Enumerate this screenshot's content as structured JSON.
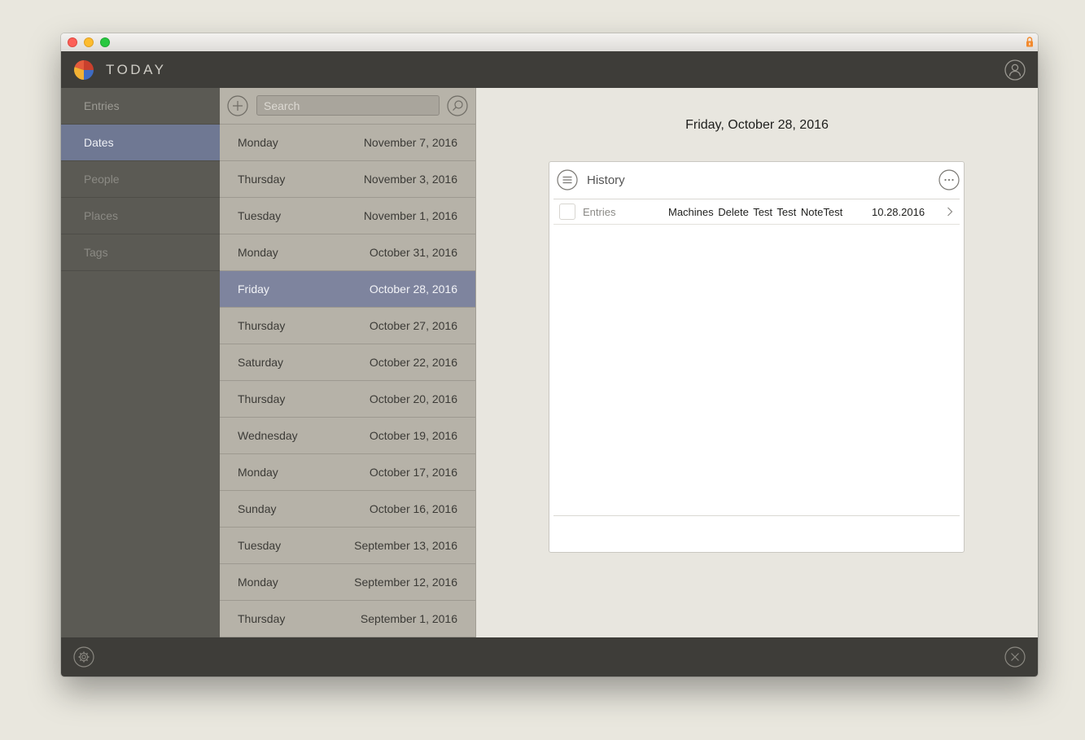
{
  "app": {
    "title": "TODAY"
  },
  "sidebar": {
    "items": [
      {
        "label": "Entries"
      },
      {
        "label": "Dates"
      },
      {
        "label": "People"
      },
      {
        "label": "Places"
      },
      {
        "label": "Tags"
      }
    ],
    "active_index": 1
  },
  "search": {
    "placeholder": "Search",
    "value": ""
  },
  "dates": [
    {
      "day": "Monday",
      "date": "November 7, 2016"
    },
    {
      "day": "Thursday",
      "date": "November 3, 2016"
    },
    {
      "day": "Tuesday",
      "date": "November 1, 2016"
    },
    {
      "day": "Monday",
      "date": "October 31, 2016"
    },
    {
      "day": "Friday",
      "date": "October 28, 2016"
    },
    {
      "day": "Thursday",
      "date": "October 27, 2016"
    },
    {
      "day": "Saturday",
      "date": "October 22, 2016"
    },
    {
      "day": "Thursday",
      "date": "October 20, 2016"
    },
    {
      "day": "Wednesday",
      "date": "October 19, 2016"
    },
    {
      "day": "Monday",
      "date": "October 17, 2016"
    },
    {
      "day": "Sunday",
      "date": "October 16, 2016"
    },
    {
      "day": "Tuesday",
      "date": "September 13, 2016"
    },
    {
      "day": "Monday",
      "date": "September 12, 2016"
    },
    {
      "day": "Thursday",
      "date": "September 1, 2016"
    }
  ],
  "selected_date_index": 4,
  "content": {
    "title": "Friday, October 28, 2016",
    "card": {
      "title": "History",
      "entries": [
        {
          "type": "Entries",
          "title": "Machines  Delete Test  Test NoteTest",
          "date": "10.28.2016"
        }
      ]
    }
  },
  "colors": {
    "accent": "#6f7893",
    "selected_row": "#7e849e",
    "appbar": "#3e3d39",
    "sidebar": "#5b5a54"
  },
  "icons": {
    "logo": "today-logo-icon",
    "account": "user-icon",
    "add": "plus-icon",
    "search": "search-icon",
    "menu": "list-icon",
    "more": "ellipsis-icon",
    "chevron": "chevron-right-icon",
    "settings": "gear-icon",
    "close": "close-icon",
    "lock": "lock-icon"
  }
}
